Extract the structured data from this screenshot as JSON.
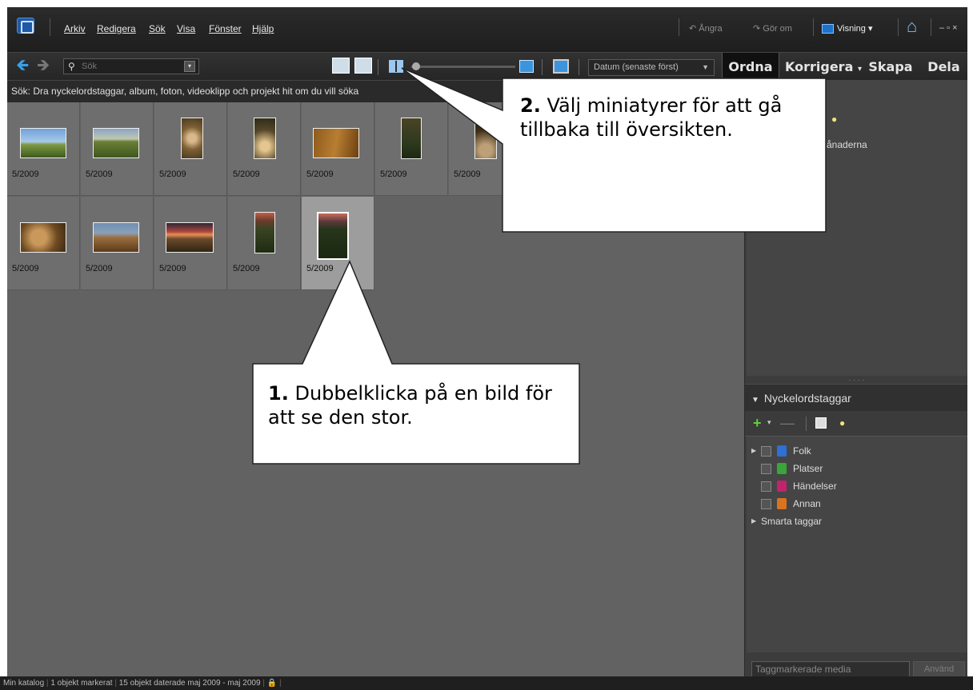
{
  "menubar": {
    "items": [
      "Arkiv",
      "Redigera",
      "Sök",
      "Visa",
      "Fönster",
      "Hjälp"
    ],
    "undo_label": "Ångra",
    "redo_label": "Gör om",
    "view_label": "Visning",
    "window_controls": "– ▫ ×"
  },
  "toolbar": {
    "search_placeholder": "Sök",
    "sort_label": "Datum (senaste först)",
    "tabs": [
      "Ordna",
      "Korrigera",
      "Skapa",
      "Dela"
    ],
    "korrigera_arrow": "▾"
  },
  "search_hint": "Sök: Dra nyckelordstaggar, album, foton, videoklipp och projekt hit om du vill söka",
  "photos": [
    {
      "date": "5/2009"
    },
    {
      "date": "5/2009"
    },
    {
      "date": "5/2009"
    },
    {
      "date": "5/2009"
    },
    {
      "date": "5/2009"
    },
    {
      "date": "5/2009"
    },
    {
      "date": "5/2009"
    },
    {
      "date": "5/2009"
    },
    {
      "date": "5/2009"
    },
    {
      "date": "5/2009"
    },
    {
      "date": "5/2009"
    },
    {
      "date": "5/2009"
    }
  ],
  "panel": {
    "upper_text": "6 månaderna",
    "tags_header": "Nyckelordstaggar",
    "tags": [
      "Folk",
      "Platser",
      "Händelser",
      "Annan"
    ],
    "smart_tags": "Smarta taggar",
    "tagged_media_placeholder": "Taggmarkerade media",
    "apply_label": "Använd"
  },
  "statusbar": {
    "catalog": "Min katalog",
    "selected": "1 objekt markerat",
    "count": "15 objekt daterade maj 2009 - maj 2009"
  },
  "callouts": {
    "c1_num": "1.",
    "c1_text": "Dubbelklicka på en bild för att se den stor.",
    "c2_num": "2.",
    "c2_text": "Välj miniatyrer för att gå tillbaka till översikten."
  },
  "colors": {
    "accent_blue": "#1e73c8",
    "tag_folk": "#2f6fd6",
    "tag_platser": "#3aa53a",
    "tag_handelser": "#c0246e",
    "tag_annan": "#d87320"
  }
}
